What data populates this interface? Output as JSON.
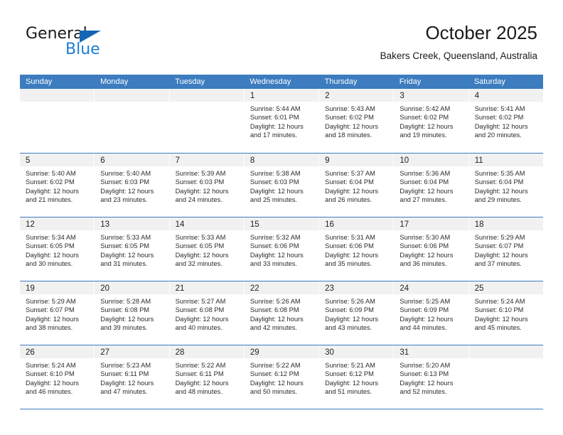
{
  "brand": {
    "name_top": "General",
    "name_bottom": "Blue",
    "accent_color": "#1a7fd4",
    "triangle_color": "#1565b5"
  },
  "header": {
    "title": "October 2025",
    "subtitle": "Bakers Creek, Queensland, Australia"
  },
  "calendar": {
    "header_bg": "#3c7cbf",
    "day_band_bg": "#f1f1f1",
    "weekdays": [
      "Sunday",
      "Monday",
      "Tuesday",
      "Wednesday",
      "Thursday",
      "Friday",
      "Saturday"
    ],
    "weeks": [
      [
        {
          "day": "",
          "lines": []
        },
        {
          "day": "",
          "lines": []
        },
        {
          "day": "",
          "lines": []
        },
        {
          "day": "1",
          "lines": [
            "Sunrise: 5:44 AM",
            "Sunset: 6:01 PM",
            "Daylight: 12 hours",
            "and 17 minutes."
          ]
        },
        {
          "day": "2",
          "lines": [
            "Sunrise: 5:43 AM",
            "Sunset: 6:02 PM",
            "Daylight: 12 hours",
            "and 18 minutes."
          ]
        },
        {
          "day": "3",
          "lines": [
            "Sunrise: 5:42 AM",
            "Sunset: 6:02 PM",
            "Daylight: 12 hours",
            "and 19 minutes."
          ]
        },
        {
          "day": "4",
          "lines": [
            "Sunrise: 5:41 AM",
            "Sunset: 6:02 PM",
            "Daylight: 12 hours",
            "and 20 minutes."
          ]
        }
      ],
      [
        {
          "day": "5",
          "lines": [
            "Sunrise: 5:40 AM",
            "Sunset: 6:02 PM",
            "Daylight: 12 hours",
            "and 21 minutes."
          ]
        },
        {
          "day": "6",
          "lines": [
            "Sunrise: 5:40 AM",
            "Sunset: 6:03 PM",
            "Daylight: 12 hours",
            "and 23 minutes."
          ]
        },
        {
          "day": "7",
          "lines": [
            "Sunrise: 5:39 AM",
            "Sunset: 6:03 PM",
            "Daylight: 12 hours",
            "and 24 minutes."
          ]
        },
        {
          "day": "8",
          "lines": [
            "Sunrise: 5:38 AM",
            "Sunset: 6:03 PM",
            "Daylight: 12 hours",
            "and 25 minutes."
          ]
        },
        {
          "day": "9",
          "lines": [
            "Sunrise: 5:37 AM",
            "Sunset: 6:04 PM",
            "Daylight: 12 hours",
            "and 26 minutes."
          ]
        },
        {
          "day": "10",
          "lines": [
            "Sunrise: 5:36 AM",
            "Sunset: 6:04 PM",
            "Daylight: 12 hours",
            "and 27 minutes."
          ]
        },
        {
          "day": "11",
          "lines": [
            "Sunrise: 5:35 AM",
            "Sunset: 6:04 PM",
            "Daylight: 12 hours",
            "and 29 minutes."
          ]
        }
      ],
      [
        {
          "day": "12",
          "lines": [
            "Sunrise: 5:34 AM",
            "Sunset: 6:05 PM",
            "Daylight: 12 hours",
            "and 30 minutes."
          ]
        },
        {
          "day": "13",
          "lines": [
            "Sunrise: 5:33 AM",
            "Sunset: 6:05 PM",
            "Daylight: 12 hours",
            "and 31 minutes."
          ]
        },
        {
          "day": "14",
          "lines": [
            "Sunrise: 5:33 AM",
            "Sunset: 6:05 PM",
            "Daylight: 12 hours",
            "and 32 minutes."
          ]
        },
        {
          "day": "15",
          "lines": [
            "Sunrise: 5:32 AM",
            "Sunset: 6:06 PM",
            "Daylight: 12 hours",
            "and 33 minutes."
          ]
        },
        {
          "day": "16",
          "lines": [
            "Sunrise: 5:31 AM",
            "Sunset: 6:06 PM",
            "Daylight: 12 hours",
            "and 35 minutes."
          ]
        },
        {
          "day": "17",
          "lines": [
            "Sunrise: 5:30 AM",
            "Sunset: 6:06 PM",
            "Daylight: 12 hours",
            "and 36 minutes."
          ]
        },
        {
          "day": "18",
          "lines": [
            "Sunrise: 5:29 AM",
            "Sunset: 6:07 PM",
            "Daylight: 12 hours",
            "and 37 minutes."
          ]
        }
      ],
      [
        {
          "day": "19",
          "lines": [
            "Sunrise: 5:29 AM",
            "Sunset: 6:07 PM",
            "Daylight: 12 hours",
            "and 38 minutes."
          ]
        },
        {
          "day": "20",
          "lines": [
            "Sunrise: 5:28 AM",
            "Sunset: 6:08 PM",
            "Daylight: 12 hours",
            "and 39 minutes."
          ]
        },
        {
          "day": "21",
          "lines": [
            "Sunrise: 5:27 AM",
            "Sunset: 6:08 PM",
            "Daylight: 12 hours",
            "and 40 minutes."
          ]
        },
        {
          "day": "22",
          "lines": [
            "Sunrise: 5:26 AM",
            "Sunset: 6:08 PM",
            "Daylight: 12 hours",
            "and 42 minutes."
          ]
        },
        {
          "day": "23",
          "lines": [
            "Sunrise: 5:26 AM",
            "Sunset: 6:09 PM",
            "Daylight: 12 hours",
            "and 43 minutes."
          ]
        },
        {
          "day": "24",
          "lines": [
            "Sunrise: 5:25 AM",
            "Sunset: 6:09 PM",
            "Daylight: 12 hours",
            "and 44 minutes."
          ]
        },
        {
          "day": "25",
          "lines": [
            "Sunrise: 5:24 AM",
            "Sunset: 6:10 PM",
            "Daylight: 12 hours",
            "and 45 minutes."
          ]
        }
      ],
      [
        {
          "day": "26",
          "lines": [
            "Sunrise: 5:24 AM",
            "Sunset: 6:10 PM",
            "Daylight: 12 hours",
            "and 46 minutes."
          ]
        },
        {
          "day": "27",
          "lines": [
            "Sunrise: 5:23 AM",
            "Sunset: 6:11 PM",
            "Daylight: 12 hours",
            "and 47 minutes."
          ]
        },
        {
          "day": "28",
          "lines": [
            "Sunrise: 5:22 AM",
            "Sunset: 6:11 PM",
            "Daylight: 12 hours",
            "and 48 minutes."
          ]
        },
        {
          "day": "29",
          "lines": [
            "Sunrise: 5:22 AM",
            "Sunset: 6:12 PM",
            "Daylight: 12 hours",
            "and 50 minutes."
          ]
        },
        {
          "day": "30",
          "lines": [
            "Sunrise: 5:21 AM",
            "Sunset: 6:12 PM",
            "Daylight: 12 hours",
            "and 51 minutes."
          ]
        },
        {
          "day": "31",
          "lines": [
            "Sunrise: 5:20 AM",
            "Sunset: 6:13 PM",
            "Daylight: 12 hours",
            "and 52 minutes."
          ]
        },
        {
          "day": "",
          "lines": []
        }
      ]
    ]
  }
}
